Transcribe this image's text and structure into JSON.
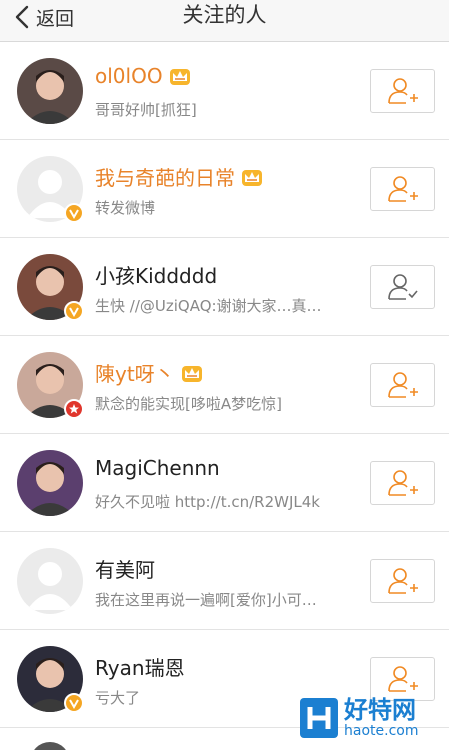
{
  "nav": {
    "back_label": "返回",
    "title": "关注的人"
  },
  "users": [
    {
      "name": "ol0lOO",
      "desc": "哥哥好帅[抓狂]",
      "vip": true,
      "badge": "none",
      "followed": false,
      "avatar_color": "#5a4a46"
    },
    {
      "name": "我与奇葩的日常",
      "desc": "转发微博",
      "vip": true,
      "badge": "v",
      "followed": false,
      "avatar_color": "#e6e6e6"
    },
    {
      "name": "小孩Kiddddd",
      "desc": "生快 //@UziQAQ:谢谢大家…真…",
      "vip": false,
      "badge": "v",
      "followed": true,
      "avatar_color": "#7a4a3c"
    },
    {
      "name": "陳yt呀丶",
      "desc": "默念的能实现[哆啦A梦吃惊]",
      "vip": true,
      "badge": "red",
      "followed": false,
      "avatar_color": "#c9a89a"
    },
    {
      "name": "MagiChennn",
      "desc": "好久不见啦 http://t.cn/R2WJL4k",
      "vip": false,
      "badge": "none",
      "followed": false,
      "avatar_color": "#5b3f6e"
    },
    {
      "name": "有美阿",
      "desc": "我在这里再说一遍啊[爱你]小可…",
      "vip": false,
      "badge": "none",
      "followed": false,
      "avatar_color": "#e6e6e6"
    },
    {
      "name": "Ryan瑞恩",
      "desc": "亏大了",
      "vip": false,
      "badge": "v",
      "followed": false,
      "avatar_color": "#2c2c3a"
    }
  ],
  "watermark": {
    "main": "好特网",
    "sub": "haote.com",
    "logo_letter": "H"
  },
  "colors": {
    "vip_name": "#e8832a",
    "verified_badge": "#f5a623",
    "red_badge": "#e0362c",
    "follow_icon": "#f08a24",
    "followed_icon": "#666666"
  }
}
